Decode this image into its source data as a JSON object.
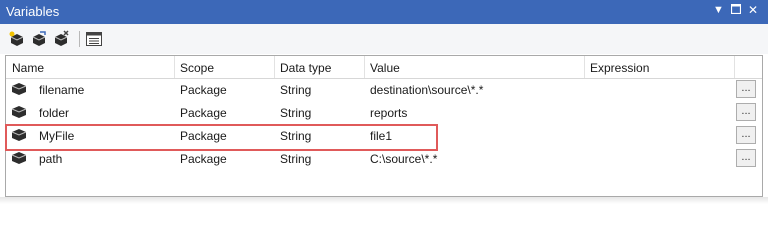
{
  "window": {
    "title": "Variables",
    "pin_icon": "dropdown-arrow-icon",
    "maximize_icon": "maximize-icon",
    "close_label": "✕"
  },
  "toolbar": {
    "buttons": [
      {
        "icon": "add-variable-icon"
      },
      {
        "icon": "move-variable-icon"
      },
      {
        "icon": "delete-variable-icon"
      },
      {
        "icon": "grid-options-icon"
      }
    ]
  },
  "grid": {
    "columns": [
      "Name",
      "Scope",
      "Data type",
      "Value",
      "Expression"
    ],
    "rows": [
      {
        "name": "filename",
        "scope": "Package",
        "type": "String",
        "value": "destination\\source\\*.*",
        "expression": "",
        "ellipsis": "..."
      },
      {
        "name": "folder",
        "scope": "Package",
        "type": "String",
        "value": "reports",
        "expression": "",
        "ellipsis": "..."
      },
      {
        "name": "MyFile",
        "scope": "Package",
        "type": "String",
        "value": "file1",
        "expression": "",
        "ellipsis": "..."
      },
      {
        "name": "path",
        "scope": "Package",
        "type": "String",
        "value": "C:\\source\\*.*",
        "expression": "",
        "ellipsis": "..."
      }
    ],
    "highlighted_row": "MyFile",
    "highlight_color": "#e05a5a"
  },
  "colors": {
    "titlebar": "#3c68b8",
    "toolbar_bg": "#f5f6f8"
  }
}
